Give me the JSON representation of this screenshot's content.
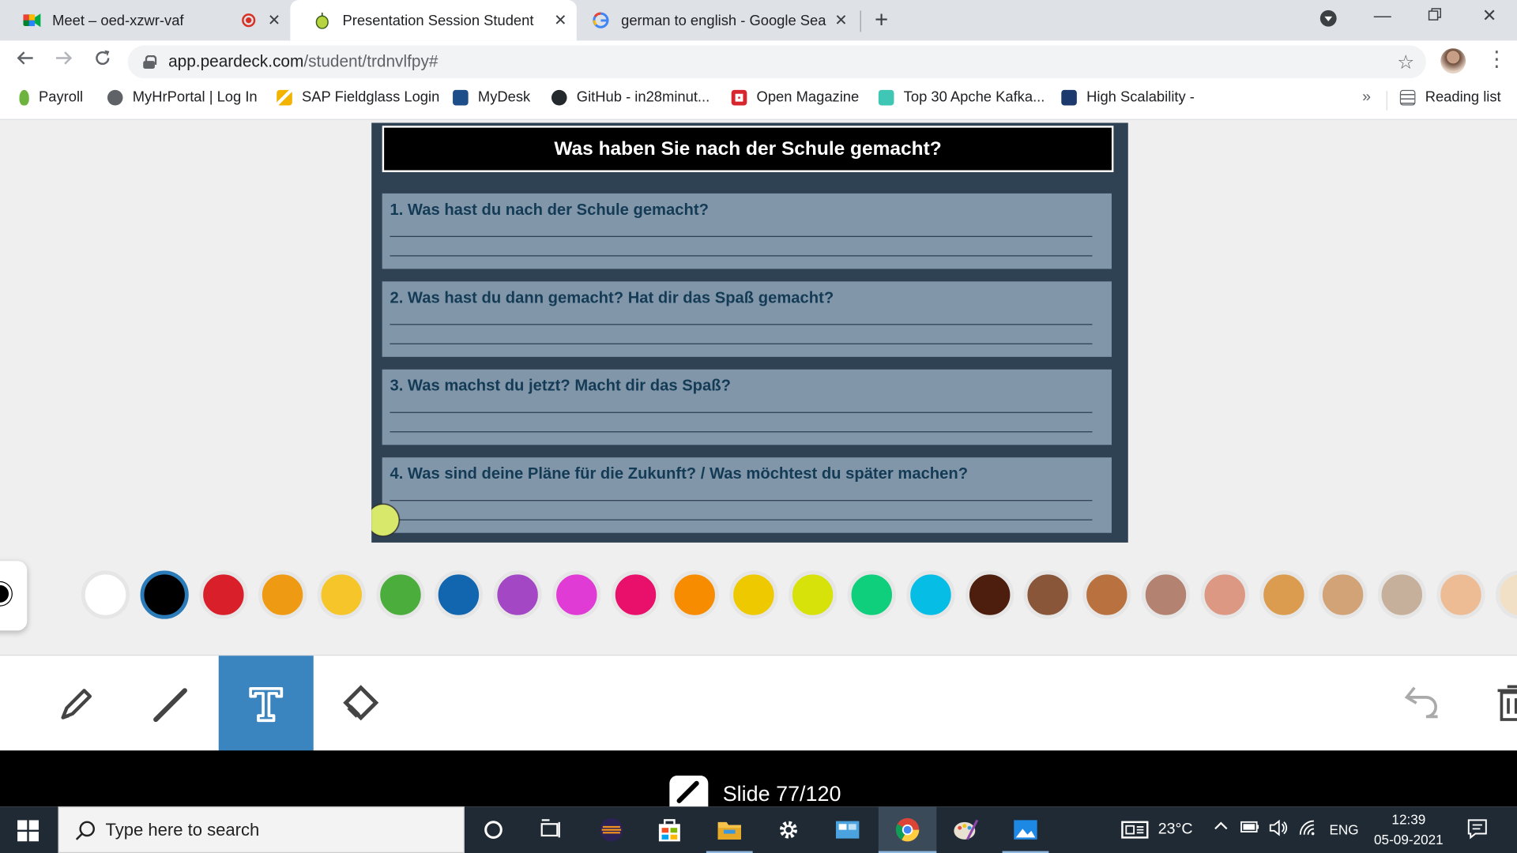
{
  "browser": {
    "tabs": [
      {
        "title": "Meet – oed-xzwr-vaf",
        "active": false
      },
      {
        "title": "Presentation Session Student",
        "active": true
      },
      {
        "title": "german to english - Google Sear",
        "active": false
      }
    ],
    "address": {
      "domain": "app.peardeck.com",
      "path": "/student/trdnvlfpy#"
    },
    "bookmarks": [
      {
        "label": "Payroll",
        "icon_color": "#6fb33f"
      },
      {
        "label": "MyHrPortal | Log In",
        "icon_color": "#5f6368"
      },
      {
        "label": "SAP Fieldglass Login",
        "icon_color": "#f2b400"
      },
      {
        "label": "MyDesk",
        "icon_color": "#1d4e89"
      },
      {
        "label": "GitHub - in28minut...",
        "icon_color": "#24292e"
      },
      {
        "label": "Open Magazine",
        "icon_color": "#d7262e"
      },
      {
        "label": "Top 30 Apche Kafka...",
        "icon_color": "#3fc6b5"
      },
      {
        "label": "High Scalability -",
        "icon_color": "#1c3a6e"
      }
    ],
    "more_bookmarks": "»",
    "reading_list": "Reading list"
  },
  "slide": {
    "title": "Was haben Sie nach der Schule gemacht?",
    "questions": [
      "1. Was hast du nach der Schule gemacht?",
      "2. Was hast du dann gemacht? Hat dir das Spaß gemacht?",
      "3. Was machst du jetzt? Macht dir das Spaß?",
      "4. Was sind deine Pläne für die Zukunft? / Was möchtest du später machen?"
    ]
  },
  "palette": {
    "selected_index": 1,
    "colors": [
      "#ffffff",
      "#000000",
      "#d9202a",
      "#ef9a13",
      "#f6c52a",
      "#4bad3b",
      "#1266b0",
      "#a347c4",
      "#e03bd4",
      "#e8106a",
      "#f78c00",
      "#eec900",
      "#d7e20a",
      "#0fcf7c",
      "#06bde6",
      "#4d1d0e",
      "#8a563a",
      "#b9723f",
      "#b48271",
      "#dc9882",
      "#dc9c4f",
      "#d3a378",
      "#c6b09b",
      "#edbc95",
      "#f2e0c6"
    ]
  },
  "tools": {
    "items": [
      "marker",
      "pen",
      "text",
      "eraser"
    ],
    "active": "text"
  },
  "counter": {
    "text": "Slide 77/120"
  },
  "taskbar": {
    "search_placeholder": "Type here to search",
    "weather": "23°C",
    "language": "ENG",
    "time": "12:39",
    "date": "05-09-2021"
  }
}
